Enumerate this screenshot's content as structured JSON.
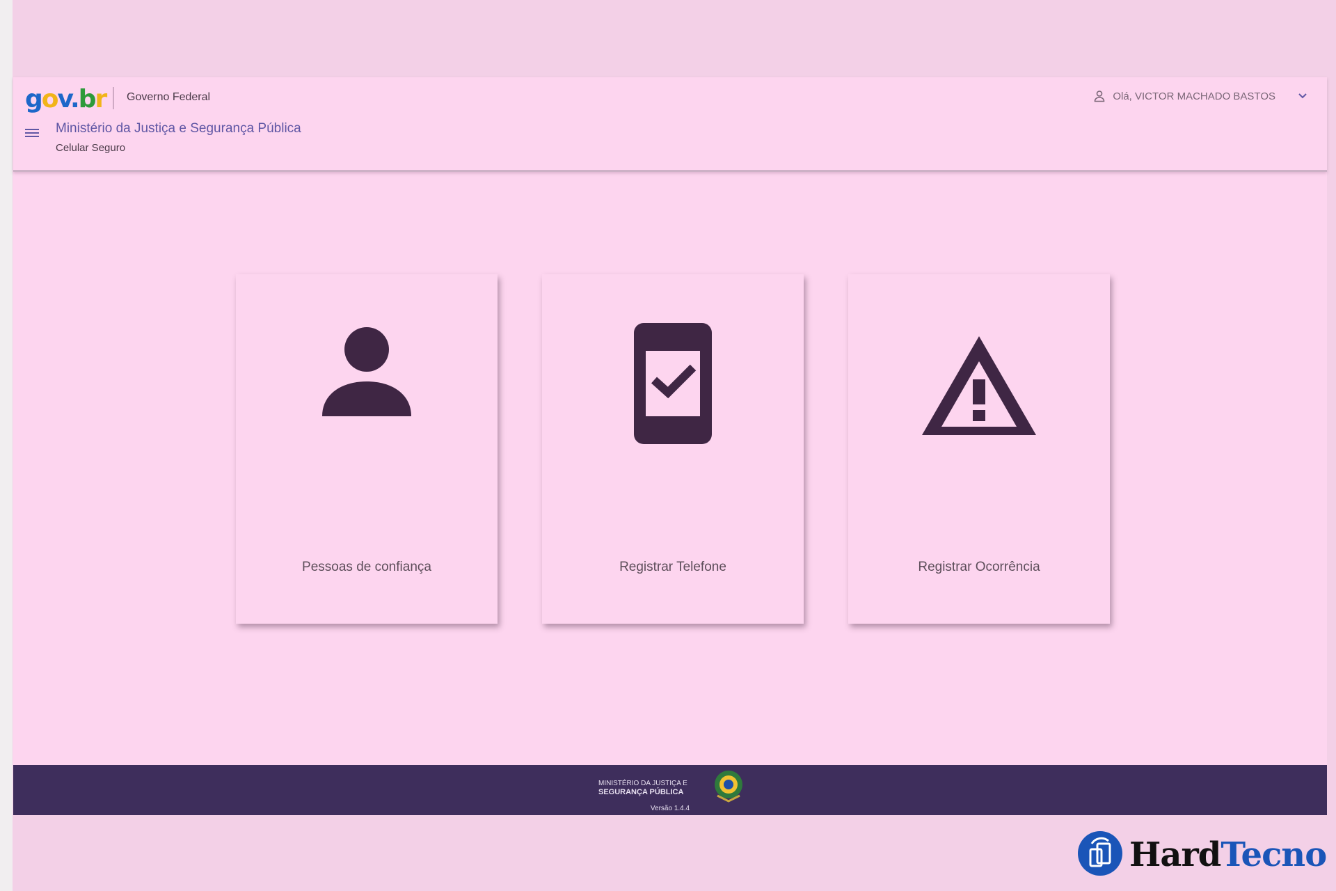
{
  "header": {
    "logo": {
      "g": "g",
      "o": "o",
      "v": "v",
      "dot": ".",
      "b": "b",
      "r": "r"
    },
    "gov_label": "Governo Federal",
    "user_greeting": "Olá, VICTOR MACHADO BASTOS",
    "ministry": "Ministério da Justiça e Segurança Pública",
    "system": "Celular Seguro",
    "icons": {
      "menu": "hamburger-menu-icon",
      "user": "user-icon",
      "chevron": "chevron-down-icon"
    }
  },
  "cards": [
    {
      "label": "Pessoas de confiança",
      "icon": "person-icon"
    },
    {
      "label": "Registrar Telefone",
      "icon": "phone-check-icon"
    },
    {
      "label": "Registrar Ocorrência",
      "icon": "warning-triangle-icon"
    }
  ],
  "footer": {
    "line1": "MINISTÉRIO DA JUSTIÇA E",
    "line2": "SEGURANÇA PÚBLICA",
    "version": "Versão 1.4.4"
  },
  "watermark": {
    "part1": "Hard",
    "part2": "Tecno"
  },
  "colors": {
    "background": "#fdd5ef",
    "footer": "#3e2e5c",
    "icon": "#3f2644",
    "ministry_text": "#5f56a4",
    "watermark_blue": "#1a55b8"
  }
}
